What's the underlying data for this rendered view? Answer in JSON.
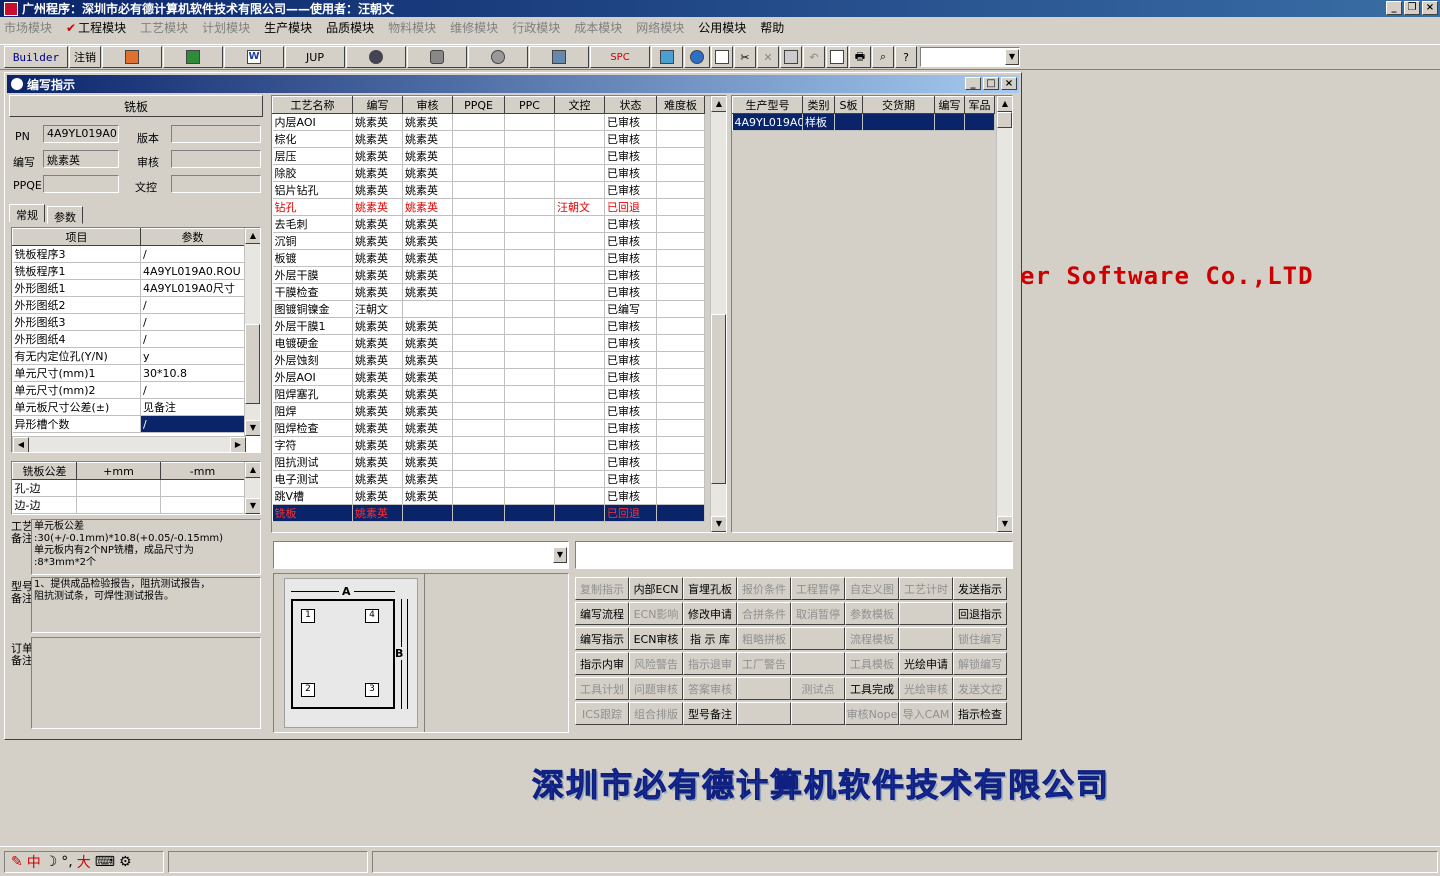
{
  "app_title": "广州程序：深圳市必有德计算机软件技术有限公司——使用者：汪朝文",
  "menu": [
    {
      "label": "市场模块",
      "enabled": false
    },
    {
      "label": "工程模块",
      "enabled": true,
      "checked": true
    },
    {
      "label": "工艺模块",
      "enabled": false
    },
    {
      "label": "计划模块",
      "enabled": false
    },
    {
      "label": "生产模块",
      "enabled": true
    },
    {
      "label": "品质模块",
      "enabled": true
    },
    {
      "label": "物料模块",
      "enabled": false
    },
    {
      "label": "维修模块",
      "enabled": false
    },
    {
      "label": "行政模块",
      "enabled": false
    },
    {
      "label": "成本模块",
      "enabled": false
    },
    {
      "label": "网络模块",
      "enabled": false
    },
    {
      "label": "公用模块",
      "enabled": true
    },
    {
      "label": "帮助",
      "enabled": true
    }
  ],
  "toolbar": {
    "builder": "Builder",
    "logout": "注销",
    "jup": "JUP",
    "spc": "SPC",
    "w": "W"
  },
  "bg_text": {
    "software": "er Software Co.,LTD",
    "company": "深圳市必有德计算机软件技术有限公司"
  },
  "window": {
    "title": "编写指示"
  },
  "left": {
    "header": "铣板",
    "pn_label": "PN",
    "pn_value": "4A9YL019A0",
    "version_label": "版本",
    "version_value": "",
    "writer_label": "编写",
    "writer_value": "姚素英",
    "review_label": "审核",
    "review_value": "",
    "ppqe_label": "PPQE",
    "ppqe_value": "",
    "doc_label": "文控",
    "doc_value": "",
    "tabs": [
      "常规",
      "参数"
    ],
    "param_headers": [
      "项目",
      "参数"
    ],
    "params": [
      [
        "铣板程序3",
        "/"
      ],
      [
        "铣板程序1",
        "4A9YL019A0.ROU"
      ],
      [
        "外形图纸1",
        "4A9YL019A0尺寸"
      ],
      [
        "外形图纸2",
        "/"
      ],
      [
        "外形图纸3",
        "/"
      ],
      [
        "外形图纸4",
        "/"
      ],
      [
        "有无内定位孔(Y/N)",
        "y"
      ],
      [
        "单元尺寸(mm)1",
        "30*10.8"
      ],
      [
        "单元尺寸(mm)2",
        "/"
      ],
      [
        "单元板尺寸公差(±)",
        "见备注"
      ],
      [
        "异形槽个数",
        "/"
      ]
    ],
    "tol_headers": [
      "铣板公差",
      "+mm",
      "-mm"
    ],
    "tol_rows": [
      [
        "孔-边",
        "",
        ""
      ],
      [
        "边-边",
        "",
        ""
      ]
    ],
    "note1_label": "工艺备注",
    "note1_text": "单元板公差\n:30(+/-0.1mm)*10.8(+0.05/-0.15mm)\n单元板内有2个NP铣槽，成品尺寸为\n:8*3mm*2个",
    "note2_label": "型号备注",
    "note2_text": "1、提供成品检验报告，阻抗测试报告，\n阻抗测试条，可焊性测试报告。",
    "note3_label": "订单备注",
    "note3_text": ""
  },
  "process": {
    "headers": [
      "工艺名称",
      "编写",
      "审核",
      "PPQE",
      "PPC",
      "文控",
      "状态",
      "难度板"
    ],
    "rows": [
      {
        "c": [
          "内层AOI",
          "姚素英",
          "姚素英",
          "",
          "",
          "",
          "已审核",
          ""
        ]
      },
      {
        "c": [
          "棕化",
          "姚素英",
          "姚素英",
          "",
          "",
          "",
          "已审核",
          ""
        ]
      },
      {
        "c": [
          "层压",
          "姚素英",
          "姚素英",
          "",
          "",
          "",
          "已审核",
          ""
        ]
      },
      {
        "c": [
          "除胶",
          "姚素英",
          "姚素英",
          "",
          "",
          "",
          "已审核",
          ""
        ]
      },
      {
        "c": [
          "铝片钻孔",
          "姚素英",
          "姚素英",
          "",
          "",
          "",
          "已审核",
          ""
        ]
      },
      {
        "c": [
          "钻孔",
          "姚素英",
          "姚素英",
          "",
          "",
          "汪朝文",
          "已回退",
          ""
        ],
        "s": "red"
      },
      {
        "c": [
          "去毛刺",
          "姚素英",
          "姚素英",
          "",
          "",
          "",
          "已审核",
          ""
        ]
      },
      {
        "c": [
          "沉铜",
          "姚素英",
          "姚素英",
          "",
          "",
          "",
          "已审核",
          ""
        ]
      },
      {
        "c": [
          "板镀",
          "姚素英",
          "姚素英",
          "",
          "",
          "",
          "已审核",
          ""
        ]
      },
      {
        "c": [
          "外层干膜",
          "姚素英",
          "姚素英",
          "",
          "",
          "",
          "已审核",
          ""
        ]
      },
      {
        "c": [
          "干膜检查",
          "姚素英",
          "姚素英",
          "",
          "",
          "",
          "已审核",
          ""
        ]
      },
      {
        "c": [
          "图镀铜镍金",
          "汪朝文",
          "",
          "",
          "",
          "",
          "已编写",
          ""
        ]
      },
      {
        "c": [
          "外层干膜1",
          "姚素英",
          "姚素英",
          "",
          "",
          "",
          "已审核",
          ""
        ]
      },
      {
        "c": [
          "电镀硬金",
          "姚素英",
          "姚素英",
          "",
          "",
          "",
          "已审核",
          ""
        ]
      },
      {
        "c": [
          "外层蚀刻",
          "姚素英",
          "姚素英",
          "",
          "",
          "",
          "已审核",
          ""
        ]
      },
      {
        "c": [
          "外层AOI",
          "姚素英",
          "姚素英",
          "",
          "",
          "",
          "已审核",
          ""
        ]
      },
      {
        "c": [
          "阻焊塞孔",
          "姚素英",
          "姚素英",
          "",
          "",
          "",
          "已审核",
          ""
        ]
      },
      {
        "c": [
          "阻焊",
          "姚素英",
          "姚素英",
          "",
          "",
          "",
          "已审核",
          ""
        ]
      },
      {
        "c": [
          "阻焊检查",
          "姚素英",
          "姚素英",
          "",
          "",
          "",
          "已审核",
          ""
        ]
      },
      {
        "c": [
          "字符",
          "姚素英",
          "姚素英",
          "",
          "",
          "",
          "已审核",
          ""
        ]
      },
      {
        "c": [
          "阻抗测试",
          "姚素英",
          "姚素英",
          "",
          "",
          "",
          "已审核",
          ""
        ]
      },
      {
        "c": [
          "电子测试",
          "姚素英",
          "姚素英",
          "",
          "",
          "",
          "已审核",
          ""
        ]
      },
      {
        "c": [
          "跳V槽",
          "姚素英",
          "姚素英",
          "",
          "",
          "",
          "已审核",
          ""
        ]
      },
      {
        "c": [
          "铣板",
          "姚素英",
          "",
          "",
          "",
          "",
          "已回退",
          ""
        ],
        "s": "selred"
      }
    ]
  },
  "orders": {
    "headers": [
      "生产型号",
      "类别",
      "S板",
      "交货期",
      "编写",
      "军品"
    ],
    "rows": [
      [
        "4A9YL019A0",
        "样板",
        "",
        "",
        "",
        ""
      ]
    ]
  },
  "diagram": {
    "a": "A",
    "b": "B",
    "n1": "1",
    "n2": "2",
    "n3": "3",
    "n4": "4"
  },
  "actions": [
    [
      {
        "l": "复制指示",
        "e": false
      },
      {
        "l": "内部ECN",
        "e": true
      },
      {
        "l": "盲埋孔板",
        "e": true
      },
      {
        "l": "报价条件",
        "e": false
      },
      {
        "l": "工程暂停",
        "e": false
      },
      {
        "l": "自定义图",
        "e": false
      },
      {
        "l": "工艺计时",
        "e": false
      },
      {
        "l": "发送指示",
        "e": true
      }
    ],
    [
      {
        "l": "编写流程",
        "e": true
      },
      {
        "l": "ECN影响",
        "e": false
      },
      {
        "l": "修改申请",
        "e": true
      },
      {
        "l": "合拼条件",
        "e": false
      },
      {
        "l": "取消暂停",
        "e": false
      },
      {
        "l": "参数模板",
        "e": false
      },
      {
        "l": "",
        "e": false
      },
      {
        "l": "回退指示",
        "e": true
      }
    ],
    [
      {
        "l": "编写指示",
        "e": true
      },
      {
        "l": "ECN审核",
        "e": true
      },
      {
        "l": "指 示 库",
        "e": true
      },
      {
        "l": "粗略拼板",
        "e": false
      },
      {
        "l": "",
        "e": false
      },
      {
        "l": "流程模板",
        "e": false
      },
      {
        "l": "",
        "e": false
      },
      {
        "l": "锁住编写",
        "e": false
      }
    ],
    [
      {
        "l": "指示内审",
        "e": true
      },
      {
        "l": "风险警告",
        "e": false
      },
      {
        "l": "指示退审",
        "e": false
      },
      {
        "l": "工厂警告",
        "e": false
      },
      {
        "l": "",
        "e": false
      },
      {
        "l": "工具模板",
        "e": false
      },
      {
        "l": "光绘申请",
        "e": true
      },
      {
        "l": "解锁编写",
        "e": false
      }
    ],
    [
      {
        "l": "工具计划",
        "e": false
      },
      {
        "l": "问题审核",
        "e": false
      },
      {
        "l": "答案审核",
        "e": false
      },
      {
        "l": "",
        "e": false
      },
      {
        "l": "测试点",
        "e": false
      },
      {
        "l": "工具完成",
        "e": true
      },
      {
        "l": "光绘审核",
        "e": false
      },
      {
        "l": "发送文控",
        "e": false
      }
    ],
    [
      {
        "l": "ICS跟踪",
        "e": false
      },
      {
        "l": "组合排版",
        "e": false
      },
      {
        "l": "型号备注",
        "e": true
      },
      {
        "l": "",
        "e": false
      },
      {
        "l": "",
        "e": false
      },
      {
        "l": "审核Nope",
        "e": false
      },
      {
        "l": "导入CAM",
        "e": false
      },
      {
        "l": "指示检查",
        "e": true
      }
    ]
  ],
  "ime": {
    "lang": "中",
    "mode": "大"
  }
}
